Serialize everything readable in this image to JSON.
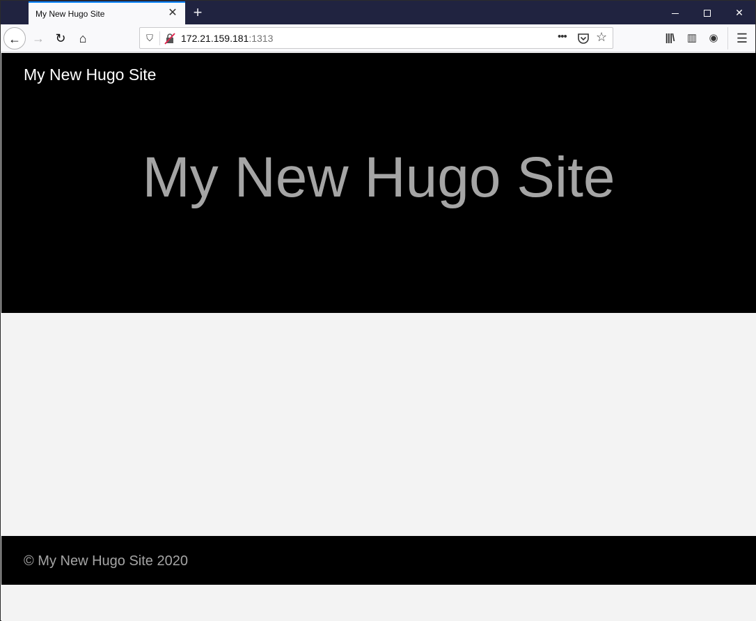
{
  "browser": {
    "tab_title": "My New Hugo Site",
    "tab_close": "✕",
    "new_tab": "+",
    "url_host": "172.21.159.181",
    "url_port": ":1313",
    "icons": {
      "back": "←",
      "forward": "→",
      "reload": "↻",
      "home": "⌂",
      "shield": "⛉",
      "more": "•••",
      "star": "☆",
      "library": "|||\\",
      "sidebar": "▥",
      "account": "◉",
      "menu": "☰",
      "close_window": "✕"
    }
  },
  "site": {
    "brand": "My New Hugo Site",
    "hero_title": "My New Hugo Site",
    "footer": "© My New Hugo Site 2020"
  }
}
